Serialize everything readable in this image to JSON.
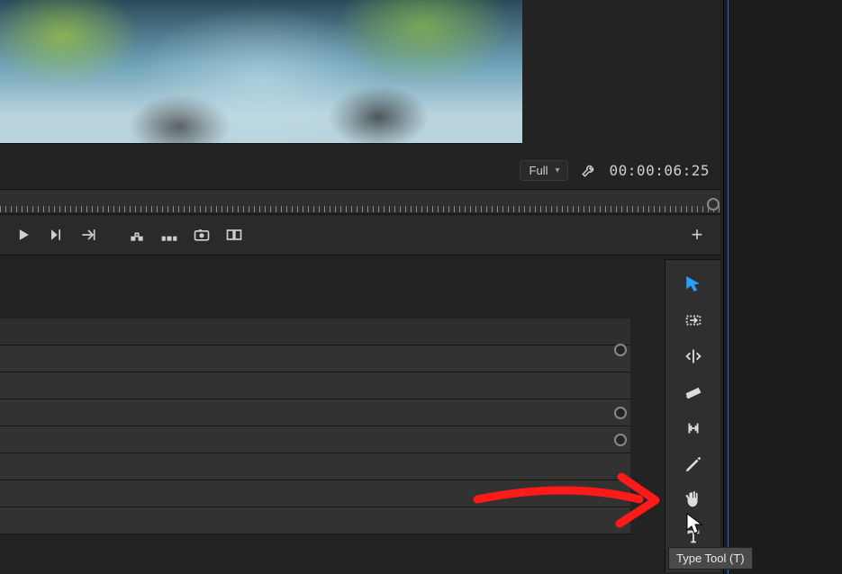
{
  "preview": {
    "resolution_label": "Full",
    "timecode": "00:00:06:25"
  },
  "transport": {
    "play_label": "Play",
    "step_label": "Step Forward",
    "jump_label": "Go to Next Edit",
    "mark_in_label": "Lift",
    "mark_span_label": "Extract",
    "export_frame_label": "Export Frame",
    "safe_margins_label": "Comparison View",
    "add_label": "+"
  },
  "tools": {
    "selection": "Selection Tool",
    "track_select": "Track Select Forward Tool",
    "ripple": "Ripple Edit Tool",
    "razor": "Razor Tool",
    "slip": "Slip Tool",
    "pen": "Pen Tool",
    "hand": "Hand Tool",
    "type": "Type Tool"
  },
  "tooltip": "Type Tool (T)"
}
